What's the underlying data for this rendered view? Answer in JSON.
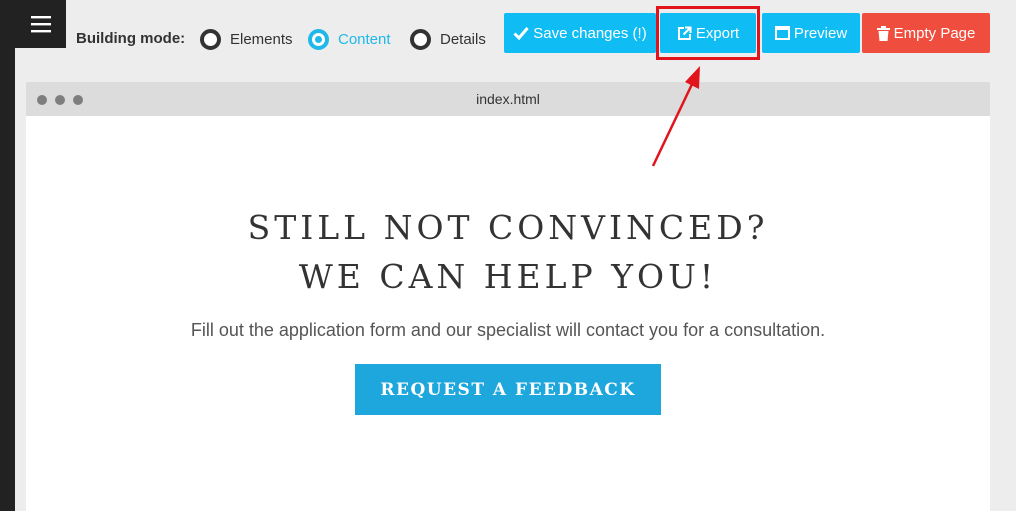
{
  "toolbar": {
    "building_mode_label": "Building mode:",
    "modes": [
      {
        "label": "Elements",
        "selected": false
      },
      {
        "label": "Content",
        "selected": true
      },
      {
        "label": "Details",
        "selected": false
      }
    ],
    "buttons": {
      "save": "Save changes (!)",
      "export": "Export",
      "preview": "Preview",
      "empty_page": "Empty Page"
    }
  },
  "browser": {
    "title": "index.html"
  },
  "content": {
    "headline_line1": "STILL NOT CONVINCED?",
    "headline_line2": "WE CAN HELP YOU!",
    "subtext": "Fill out the application form and our specialist will contact you for a consultation.",
    "cta_label": "REQUEST A FEEDBACK"
  },
  "colors": {
    "accent_blue": "#0fbdf4",
    "danger_red": "#ef4d3e",
    "cta_blue": "#1ea7dc",
    "annotation_red": "#e1141b"
  },
  "icons": {
    "menu": "hamburger-icon",
    "save": "check-icon",
    "export": "external-link-icon",
    "preview": "window-icon",
    "empty_page": "trash-icon"
  }
}
